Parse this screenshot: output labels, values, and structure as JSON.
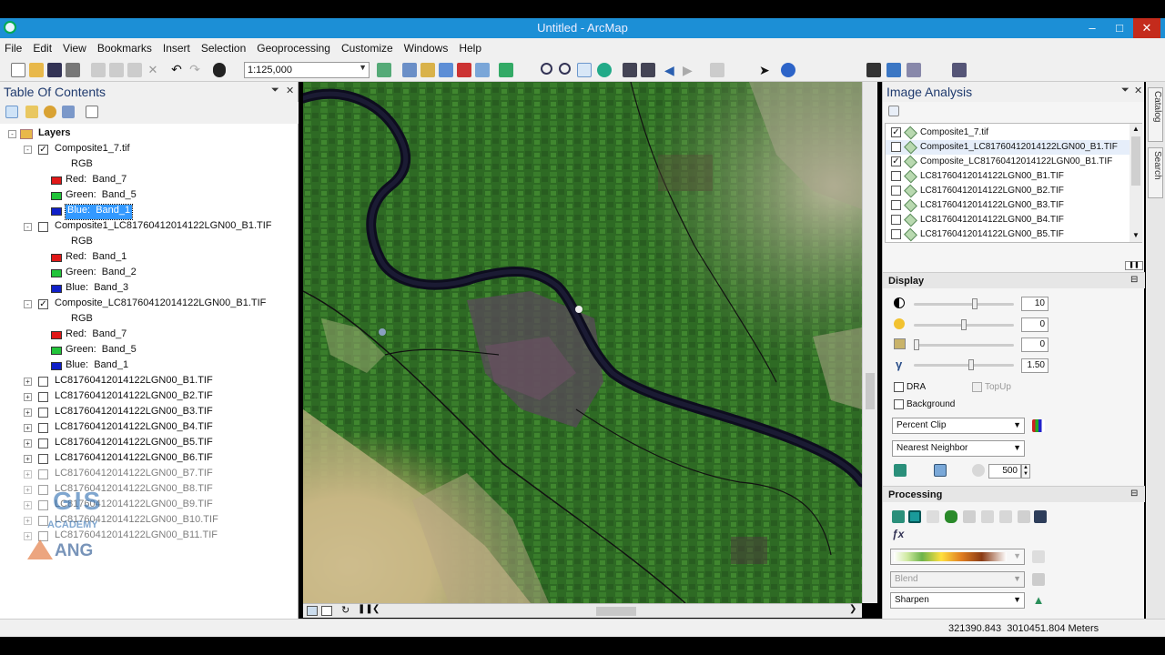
{
  "window": {
    "title": "Untitled - ArcMap"
  },
  "menu": [
    "File",
    "Edit",
    "View",
    "Bookmarks",
    "Insert",
    "Selection",
    "Geoprocessing",
    "Customize",
    "Windows",
    "Help"
  ],
  "toolbar": {
    "scale": "1:125,000"
  },
  "toc": {
    "title": "Table Of Contents",
    "root": "Layers",
    "composites": [
      {
        "name": "Composite1_7.tif",
        "checked": true,
        "rgb": "RGB",
        "red": "Band_7",
        "green": "Band_5",
        "blue": "Band_1"
      },
      {
        "name": "Composite1_LC81760412014122LGN00_B1.TIF",
        "checked": false,
        "rgb": "RGB",
        "red": "Band_1",
        "green": "Band_2",
        "blue": "Band_3"
      },
      {
        "name": "Composite_LC81760412014122LGN00_B1.TIF",
        "checked": true,
        "rgb": "RGB",
        "red": "Band_7",
        "green": "Band_5",
        "blue": "Band_1"
      }
    ],
    "labels": {
      "red": "Red:",
      "green": "Green:",
      "blue": "Blue:"
    },
    "bands": [
      "LC81760412014122LGN00_B1.TIF",
      "LC81760412014122LGN00_B2.TIF",
      "LC81760412014122LGN00_B3.TIF",
      "LC81760412014122LGN00_B4.TIF",
      "LC81760412014122LGN00_B5.TIF",
      "LC81760412014122LGN00_B6.TIF",
      "LC81760412014122LGN00_B7.TIF",
      "LC81760412014122LGN00_B8.TIF",
      "LC81760412014122LGN00_B9.TIF",
      "LC81760412014122LGN00_B10.TIF",
      "LC81760412014122LGN00_B11.TIF"
    ],
    "watermark": {
      "gis": "GIS",
      "academy": "ACADEMY",
      "ang": "ANG"
    }
  },
  "image_analysis": {
    "title": "Image Analysis",
    "layers": [
      {
        "name": "Composite1_7.tif",
        "checked": true
      },
      {
        "name": "Composite1_LC81760412014122LGN00_B1.TIF",
        "checked": false
      },
      {
        "name": "Composite_LC81760412014122LGN00_B1.TIF",
        "checked": true
      },
      {
        "name": "LC81760412014122LGN00_B1.TIF",
        "checked": false
      },
      {
        "name": "LC81760412014122LGN00_B2.TIF",
        "checked": false
      },
      {
        "name": "LC81760412014122LGN00_B3.TIF",
        "checked": false
      },
      {
        "name": "LC81760412014122LGN00_B4.TIF",
        "checked": false
      },
      {
        "name": "LC81760412014122LGN00_B5.TIF",
        "checked": false
      }
    ],
    "display": {
      "title": "Display",
      "contrast": "10",
      "brightness": "0",
      "transparency": "0",
      "gamma": "1.50",
      "contrast_level": 0.62,
      "brightness_level": 0.5,
      "transparency_level": 0.0,
      "gamma_level": 0.58,
      "dra": "DRA",
      "topup": "TopUp",
      "background": "Background",
      "stretch": "Percent Clip",
      "resample": "Nearest Neighbor",
      "dpi": "500"
    },
    "processing": {
      "title": "Processing",
      "blend": "Blend",
      "sharpen": "Sharpen"
    }
  },
  "catalog_tabs": [
    "Catalog",
    "Search"
  ],
  "status": {
    "coords": "321390.843  3010451.804 Meters"
  }
}
